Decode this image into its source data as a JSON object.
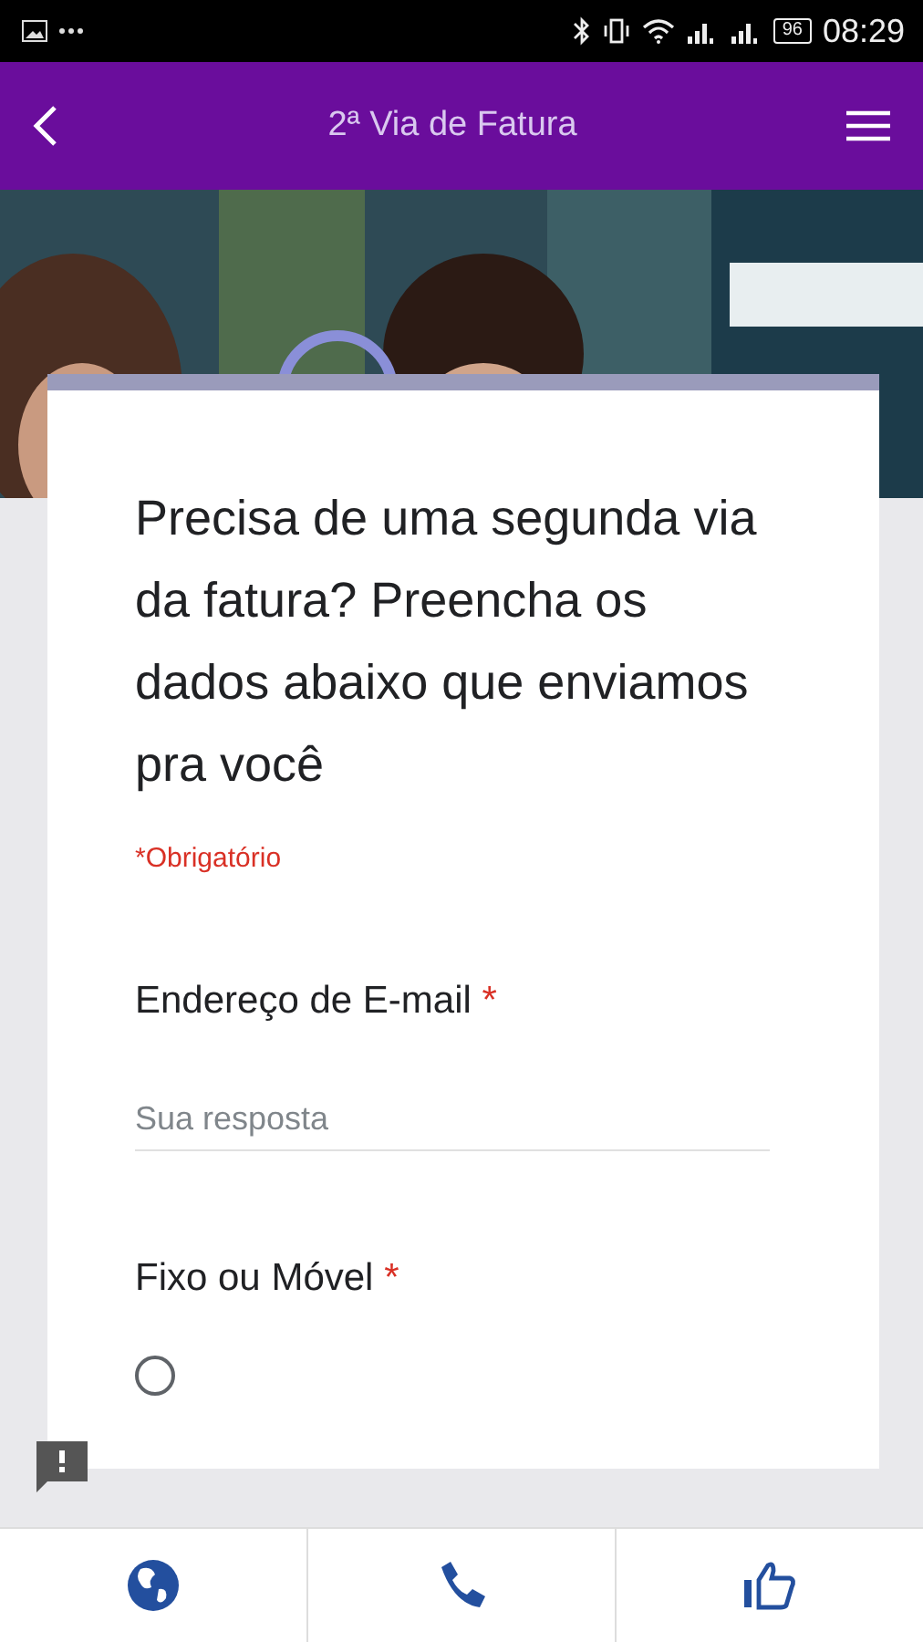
{
  "status_bar": {
    "battery": "96",
    "time": "08:29"
  },
  "header": {
    "title": "2ª Via de Fatura"
  },
  "form": {
    "title": "Precisa de uma segunda via da fatura? Preencha os dados abaixo que enviamos pra você",
    "required_note": "*Obrigatório",
    "questions": [
      {
        "kind": "text",
        "label": "Endereço de E-mail",
        "required_mark": "*",
        "placeholder": "Sua resposta"
      },
      {
        "kind": "radio",
        "label": "Fixo ou Móvel",
        "required_mark": "*",
        "selected": false
      }
    ]
  }
}
